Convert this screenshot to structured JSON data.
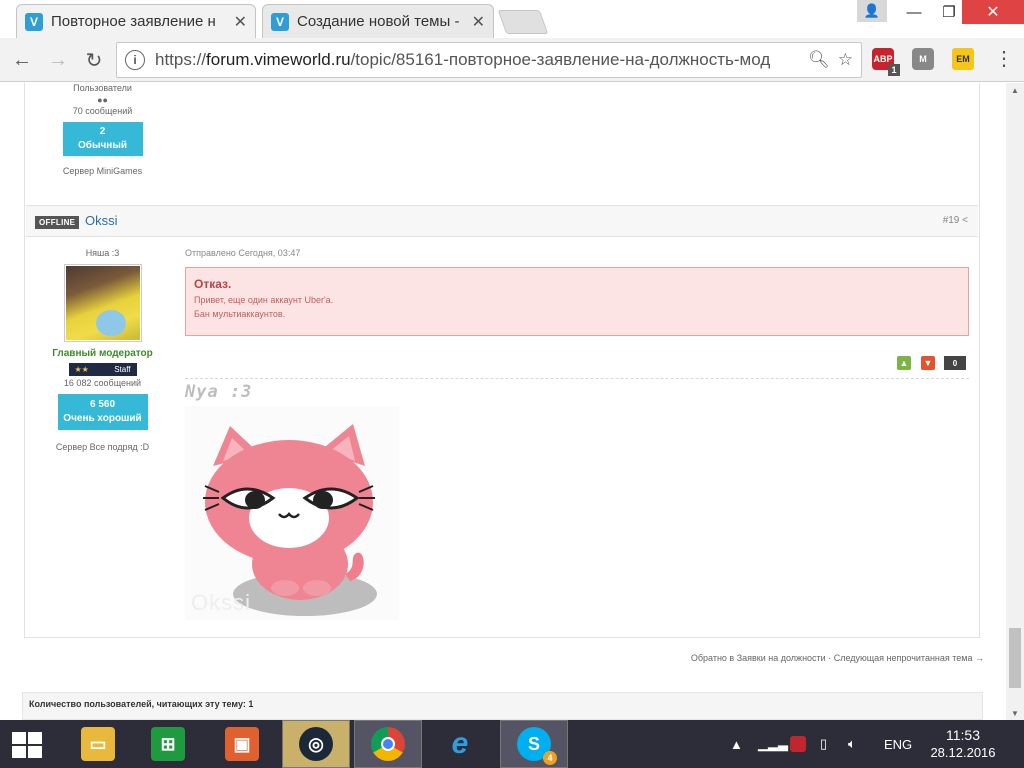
{
  "browser": {
    "tabs": [
      {
        "title": "Повторное заявление н",
        "icon": "vimeworld-favicon"
      },
      {
        "title": "Создание новой темы -",
        "icon": "vimeworld-favicon"
      }
    ],
    "url_prefix": "https://",
    "url_host": "forum.vimeworld.ru",
    "url_path": "/topic/85161-повторное-заявление-на-должность-мод",
    "extensions": {
      "abp_label": "ABP",
      "abp_badge": "1",
      "m_label": "M",
      "em_label": "EM"
    }
  },
  "prev_post": {
    "group": "Пользователи",
    "rank_pips": "●●",
    "messages": "70 сообщений",
    "rep_value": "2",
    "rep_label": "Обычный",
    "server": "Сервер MiniGames"
  },
  "post": {
    "status": "OFFLINE",
    "author": "Okssi",
    "number": "#19",
    "title": "Няша :3",
    "role": "Главный модератор",
    "staff_stars": "★★",
    "staff_label": "Staff",
    "messages": "16 082 сообщений",
    "rep_value": "6 560",
    "rep_label": "Очень хороший",
    "server": "Сервер Все подряд :D",
    "date": "Отправлено Сегодня, 03:47",
    "reject_title": "Отказ.",
    "reject_lines": [
      "Привет, еще один аккаунт Uber'a.",
      "Бан мультиаккаунтов."
    ],
    "votes": "0",
    "signature_text": "Nya :3",
    "signature_watermark": "Okssi"
  },
  "footer": {
    "back_link": "Обратно в Заявки на должности",
    "separator": " · ",
    "next_link": "Следующая непрочитанная тема →",
    "readers": "Количество пользователей, читающих эту тему: 1"
  },
  "taskbar": {
    "lang": "ENG",
    "time": "11:53",
    "date": "28.12.2016",
    "skype_badge": "4"
  },
  "colors": {
    "accent": "#36b9d6",
    "moderator": "#3d8a2b",
    "reject_bg": "#fde4e4"
  }
}
